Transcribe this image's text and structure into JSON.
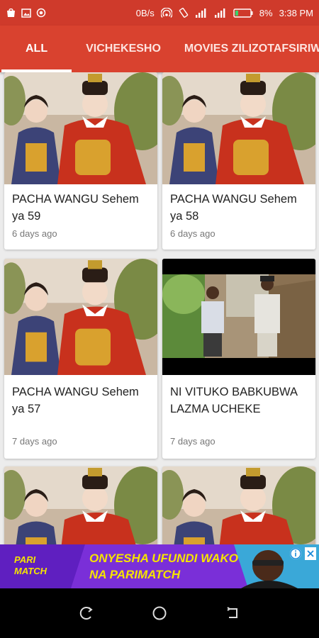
{
  "status_bar": {
    "speed": "0B/s",
    "battery": "8%",
    "time": "3:38 PM"
  },
  "tabs": [
    {
      "label": "ALL",
      "active": true
    },
    {
      "label": "VICHEKESHO",
      "active": false
    },
    {
      "label": "MOVIES ZILIZOTAFSIRIWA",
      "active": false
    }
  ],
  "videos": [
    {
      "title": "PACHA WANGU Sehem ya 59",
      "time": "6 days ago",
      "thumb": "drama-portrait"
    },
    {
      "title": "PACHA WANGU Sehem ya 58",
      "time": "6 days ago",
      "thumb": "drama-portrait"
    },
    {
      "title": "PACHA WANGU Sehem ya 57",
      "time": "7 days ago",
      "thumb": "drama-portrait"
    },
    {
      "title": "NI VITUKO BABKUBWA LAZMA UCHEKE",
      "time": "7 days ago",
      "thumb": "comedy-outdoor"
    },
    {
      "title": "",
      "time": "",
      "thumb": "drama-portrait"
    },
    {
      "title": "",
      "time": "",
      "thumb": "drama-portrait"
    }
  ],
  "ad": {
    "brand": "PARI MATCH",
    "headline_line1": "ONYESHA UFUNDI WAKO",
    "headline_line2": "NA PARIMATCH",
    "accent": "#f5e400",
    "background": "#7a2fd8"
  },
  "colors": {
    "primary": "#d9422f",
    "status": "#cf3a2b"
  }
}
